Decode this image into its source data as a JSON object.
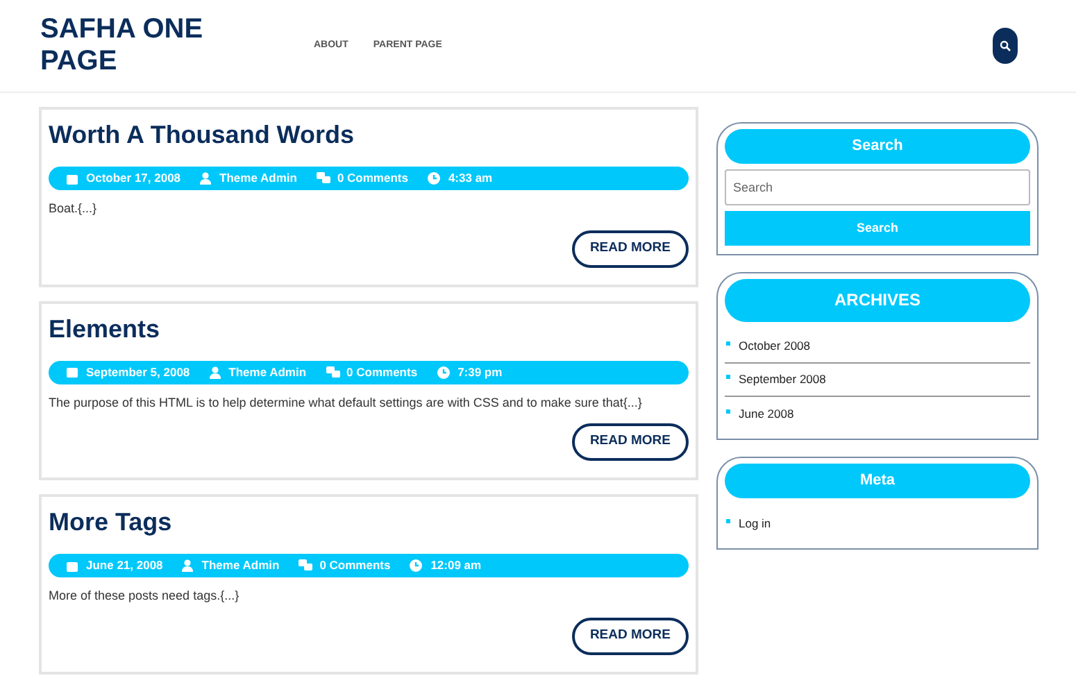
{
  "site_title": "SAFHA ONE PAGE",
  "nav": [
    {
      "label": "ABOUT"
    },
    {
      "label": "PARENT PAGE"
    }
  ],
  "posts": [
    {
      "title": "Worth A Thousand Words",
      "date": "October 17, 2008",
      "author": "Theme Admin",
      "comments": "0 Comments",
      "time": "4:33 am",
      "excerpt": "Boat.{...}",
      "button": "READ MORE"
    },
    {
      "title": "Elements",
      "date": "September 5, 2008",
      "author": "Theme Admin",
      "comments": "0 Comments",
      "time": "7:39 pm",
      "excerpt": "The purpose of this HTML is to help determine what default settings are with CSS and to make sure that{...}",
      "button": "READ MORE"
    },
    {
      "title": "More Tags",
      "date": "June 21, 2008",
      "author": "Theme Admin",
      "comments": "0 Comments",
      "time": "12:09 am",
      "excerpt": "More of these posts need tags.{...}",
      "button": "READ MORE"
    }
  ],
  "sidebar": {
    "search": {
      "title": "Search",
      "placeholder": "Search",
      "button": "Search"
    },
    "archives": {
      "title": "ARCHIVES",
      "items": [
        "October 2008",
        "September 2008",
        "June 2008"
      ]
    },
    "meta": {
      "title": "Meta",
      "items": [
        "Log in"
      ]
    }
  }
}
